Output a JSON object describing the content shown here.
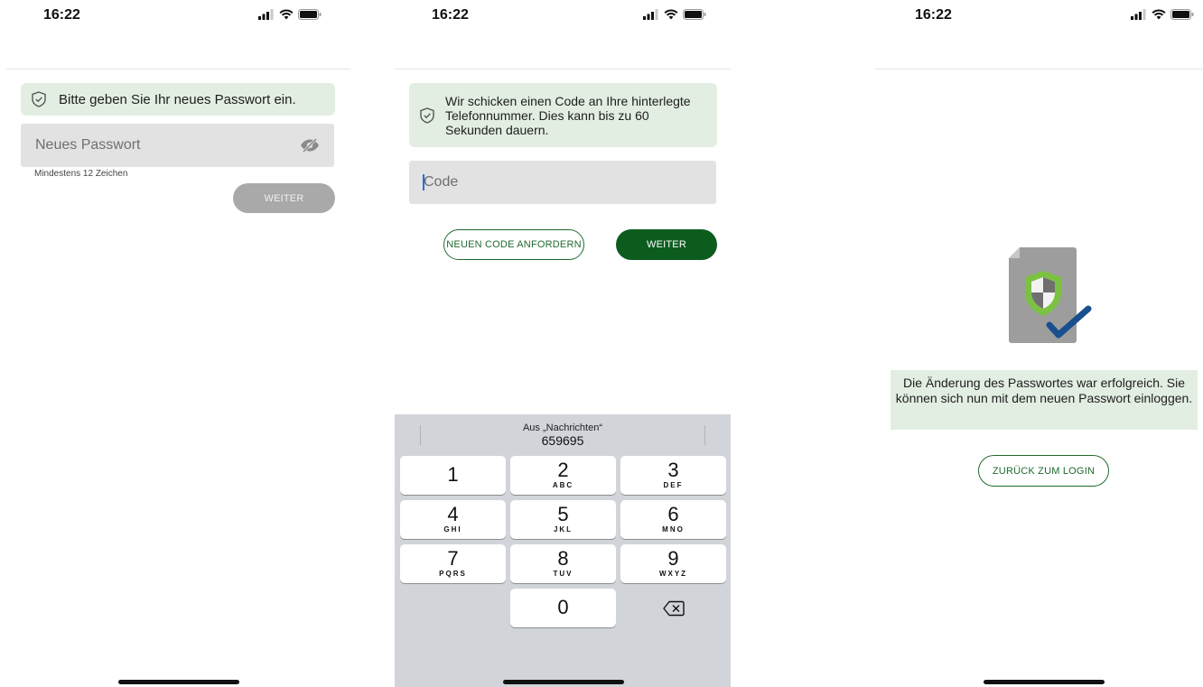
{
  "status_bar": {
    "time": "16:22"
  },
  "screen1": {
    "notice": "Bitte geben Sie Ihr neues Passwort ein.",
    "password_placeholder": "Neues Passwort",
    "hint": "Mindestens 12 Zeichen",
    "next_button": "WEITER"
  },
  "screen2": {
    "notice": "Wir schicken einen Code an Ihre hinterlegte Telefonnummer. Dies kann bis zu 60 Sekunden dauern.",
    "code_placeholder": "Code",
    "request_button": "NEUEN CODE ANFORDERN",
    "next_button": "WEITER",
    "keyboard": {
      "suggestion_source": "Aus „Nachrichten“",
      "suggestion_code": "659695",
      "keys": [
        {
          "digit": "1",
          "letters": ""
        },
        {
          "digit": "2",
          "letters": "ABC"
        },
        {
          "digit": "3",
          "letters": "DEF"
        },
        {
          "digit": "4",
          "letters": "GHI"
        },
        {
          "digit": "5",
          "letters": "JKL"
        },
        {
          "digit": "6",
          "letters": "MNO"
        },
        {
          "digit": "7",
          "letters": "PQRS"
        },
        {
          "digit": "8",
          "letters": "TUV"
        },
        {
          "digit": "9",
          "letters": "WXYZ"
        },
        {
          "digit": "0",
          "letters": ""
        }
      ]
    }
  },
  "screen3": {
    "success_message": "Die Änderung des Passwortes war erfolgreich. Sie können sich nun mit dem neuen Passwort einloggen.",
    "back_button": "ZURÜCK ZUM LOGIN"
  },
  "colors": {
    "notice_bg": "#e3eee3",
    "primary_green": "#0c5c1e",
    "disabled_gray": "#a9a9a9",
    "keyboard_bg": "#d1d4d9",
    "checkmark_blue": "#1a4f8f",
    "shield_green": "#7cc242"
  },
  "icons": [
    "signal-icon",
    "wifi-icon",
    "battery-icon",
    "shield-check-icon",
    "eye-off-icon",
    "backspace-icon",
    "document-shield-check-icon"
  ]
}
